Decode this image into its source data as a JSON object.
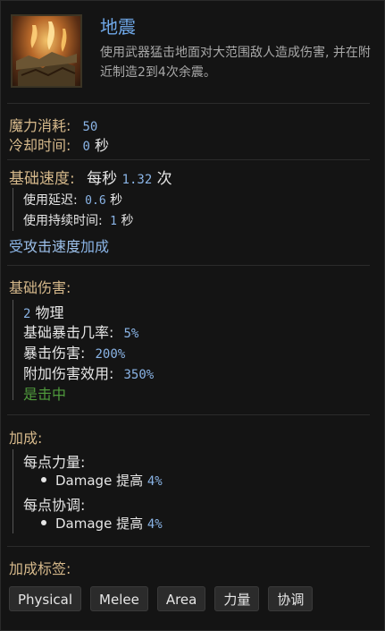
{
  "skill": {
    "name": "地震",
    "description": "使用武器猛击地面对大范围敌人造成伤害, 并在附近制造2到4次余震。",
    "icon": "earthquake-skill-icon"
  },
  "cost": {
    "mana_label": "魔力消耗:",
    "mana_value": "50",
    "cooldown_label": "冷却时间:",
    "cooldown_value": "0",
    "cooldown_unit": "秒"
  },
  "speed": {
    "label": "基础速度:",
    "prefix": "每秒",
    "value": "1.32",
    "unit": "次",
    "delay_label": "使用延迟:",
    "delay_value": "0.6",
    "delay_unit": "秒",
    "duration_label": "使用持续时间:",
    "duration_value": "1",
    "duration_unit": "秒",
    "scaling_pre": "受",
    "scaling_link": "攻击速度",
    "scaling_post": "加成"
  },
  "damage": {
    "label": "基础伤害:",
    "value": "2",
    "type": "物理",
    "crit_label": "基础暴击几率:",
    "crit_value": "5%",
    "crit_dmg_label": "暴击伤害:",
    "crit_dmg_value": "200%",
    "effect_label": "附加伤害效用:",
    "effect_value": "350%",
    "on_hit": "是击中"
  },
  "bonus": {
    "label": "加成:",
    "groups": [
      {
        "label": "每点力量:",
        "stat": "Damage",
        "verb": "提高",
        "value": "4%"
      },
      {
        "label": "每点协调:",
        "stat": "Damage",
        "verb": "提高",
        "value": "4%"
      }
    ]
  },
  "tags": {
    "label": "加成标签:",
    "items": [
      "Physical",
      "Melee",
      "Area",
      "力量",
      "协调"
    ]
  },
  "colors": {
    "title": "#6fa8e8",
    "label": "#d6b98b",
    "value": "#8ab4e6",
    "on_hit": "#4f9a3c",
    "background": "#141414"
  }
}
